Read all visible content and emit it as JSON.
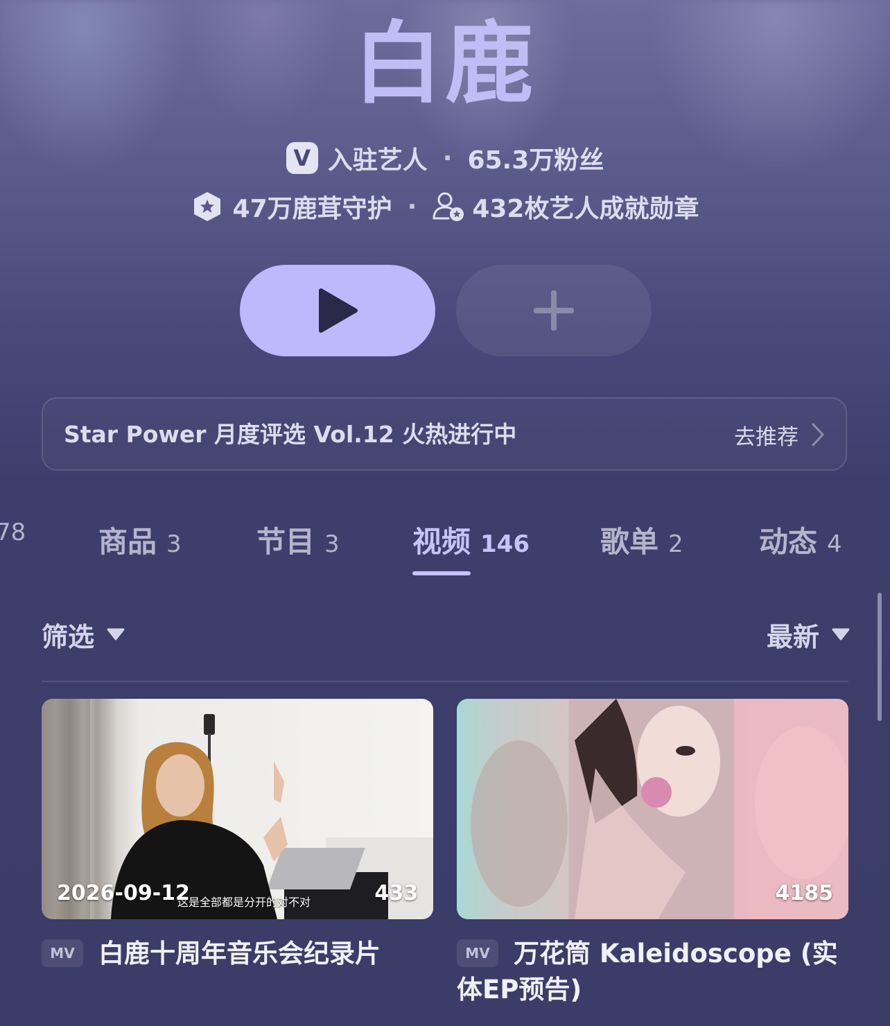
{
  "artist": {
    "name": "白鹿",
    "verified_badge": "V",
    "verified_label": "入驻艺人",
    "followers": "65.3万粉丝",
    "guardians": "47万鹿茸守护",
    "medals": "432枚艺人成就勋章",
    "separator": "·"
  },
  "actions": {
    "play_icon": "play-icon",
    "add_icon": "plus-icon"
  },
  "banner": {
    "text": "Star Power 月度评选 Vol.12 火热进行中",
    "action": "去推荐"
  },
  "tabs": [
    {
      "label": "",
      "count": "78"
    },
    {
      "label": "商品",
      "count": "3"
    },
    {
      "label": "节目",
      "count": "3"
    },
    {
      "label": "视频",
      "count": "146",
      "active": true
    },
    {
      "label": "歌单",
      "count": "2"
    },
    {
      "label": "动态",
      "count": "4"
    }
  ],
  "filter": {
    "left_label": "筛选",
    "right_label": "最新"
  },
  "videos": [
    {
      "date": "2026-09-12",
      "count": "433",
      "subtitle": "这是全部都是分开的对不对",
      "tag": "MV",
      "title": "白鹿十周年音乐会纪录片"
    },
    {
      "date": "",
      "count": "4185",
      "tag": "MV",
      "title": "万花筒 Kaleidoscope (实体EP预告)"
    }
  ],
  "colors": {
    "accent": "#c6c2fa",
    "play_button": "#bcbafc",
    "background": "#3c3c68"
  }
}
